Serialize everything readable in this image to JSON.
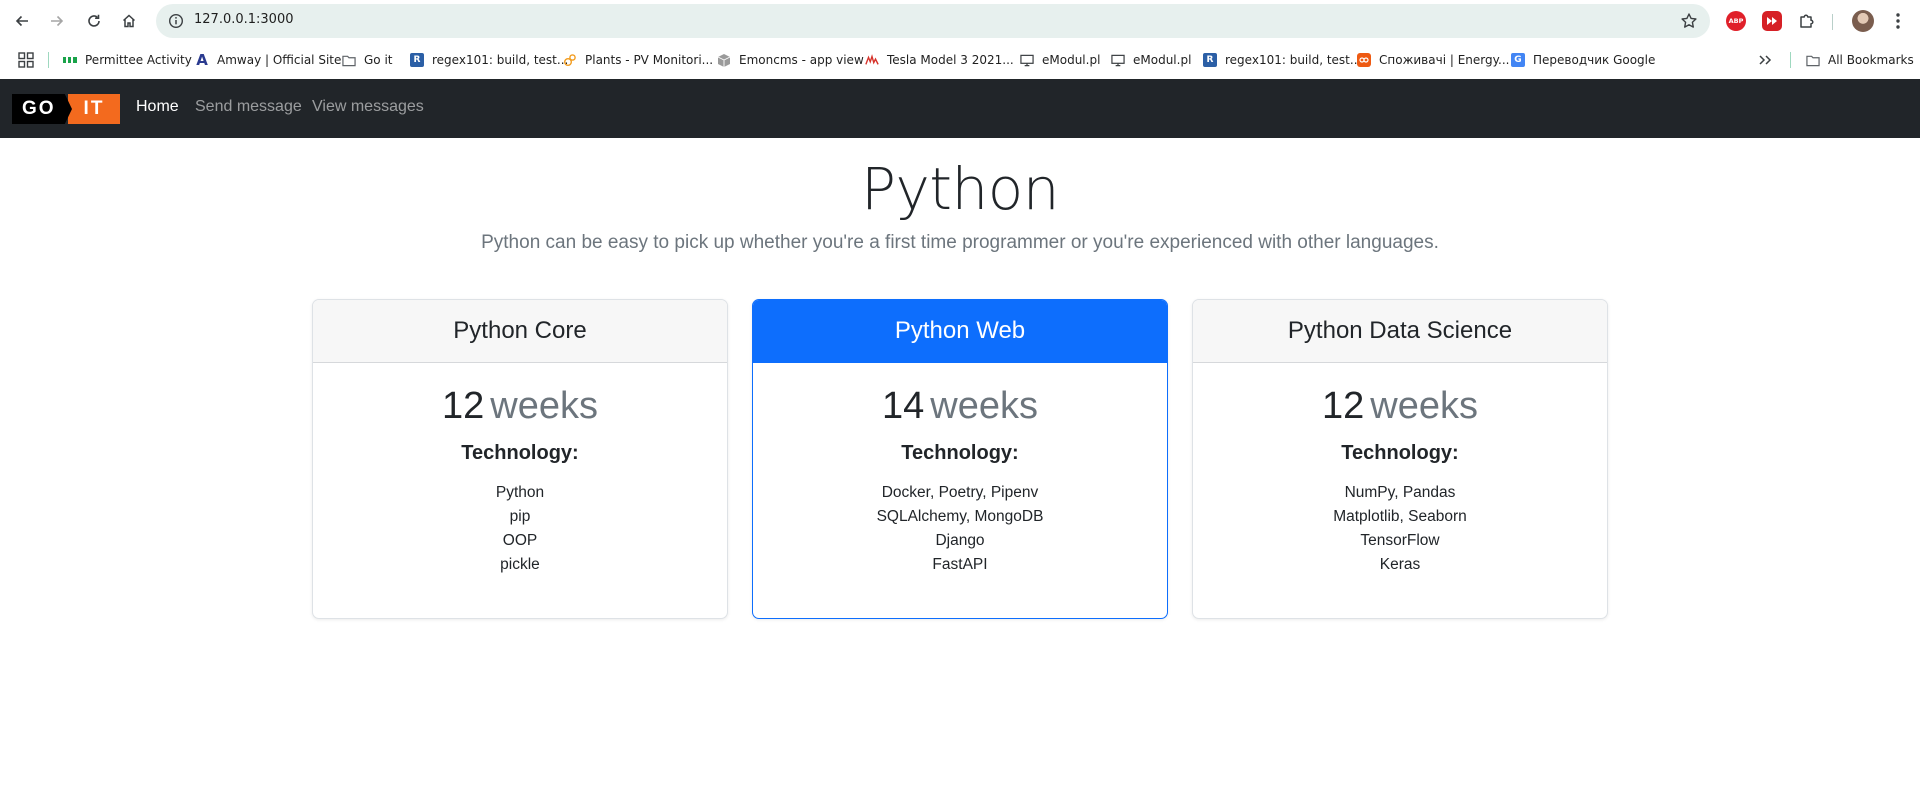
{
  "browser": {
    "url": "127.0.0.1:3000",
    "bookmarks": [
      {
        "label": "Permittee Activity",
        "icon": "permittee-favicon",
        "color": "#1aa34a"
      },
      {
        "label": "Amway | Official Site",
        "icon": "amway-favicon",
        "color": "#2a3a8f"
      },
      {
        "label": "Go it",
        "icon": "folder-icon",
        "color": "#5f6368"
      },
      {
        "label": "regex101: build, test...",
        "icon": "regex101-favicon",
        "color": "#2b5fa6"
      },
      {
        "label": "Plants - PV Monitori...",
        "icon": "pv-monitoring-favicon",
        "color": "#f29c1f"
      },
      {
        "label": "Emoncms - app view",
        "icon": "emoncms-favicon",
        "color": "#7a7a7a"
      },
      {
        "label": "Tesla Model 3 2021...",
        "icon": "tesla-favicon",
        "color": "#d6332b"
      },
      {
        "label": "eModul.pl",
        "icon": "monitor-icon",
        "color": "#3c4043"
      },
      {
        "label": "eModul.pl",
        "icon": "monitor-icon",
        "color": "#3c4043"
      },
      {
        "label": "regex101: build, test...",
        "icon": "regex101-favicon",
        "color": "#2b5fa6"
      },
      {
        "label": "Споживачі | Energy...",
        "icon": "energy-favicon",
        "color": "#ee5a12"
      },
      {
        "label": "Переводчик Google",
        "icon": "google-translate-favicon",
        "color": "#4285f4"
      }
    ],
    "all_bookmarks": "All Bookmarks",
    "extensions": {
      "abp": "ABP"
    }
  },
  "navbar": {
    "logo_left": "GO",
    "logo_right": "IT",
    "links": [
      {
        "label": "Home",
        "active": true
      },
      {
        "label": "Send message",
        "active": false
      },
      {
        "label": "View messages",
        "active": false
      }
    ],
    "accent": "#f36a1e",
    "background": "#212529"
  },
  "hero": {
    "title": "Python",
    "lead": "Python can be easy to pick up whether you're a first time programmer or you're experienced with other languages."
  },
  "tech_heading": "Technology:",
  "cards": [
    {
      "title": "Python Core",
      "duration": "12",
      "unit": "weeks",
      "highlighted": false,
      "technologies": [
        "Python",
        "pip",
        "OOP",
        "pickle"
      ]
    },
    {
      "title": "Python Web",
      "duration": "14",
      "unit": "weeks",
      "highlighted": true,
      "technologies": [
        "Docker, Poetry, Pipenv",
        "SQLAlchemy, MongoDB",
        "Django",
        "FastAPI"
      ]
    },
    {
      "title": "Python Data Science",
      "duration": "12",
      "unit": "weeks",
      "highlighted": false,
      "technologies": [
        "NumPy, Pandas",
        "Matplotlib, Seaborn",
        "TensorFlow",
        "Keras"
      ]
    }
  ],
  "colors": {
    "primary": "#0d6efd",
    "muted": "#6c757d",
    "omnibox": "#e7f0ee"
  }
}
